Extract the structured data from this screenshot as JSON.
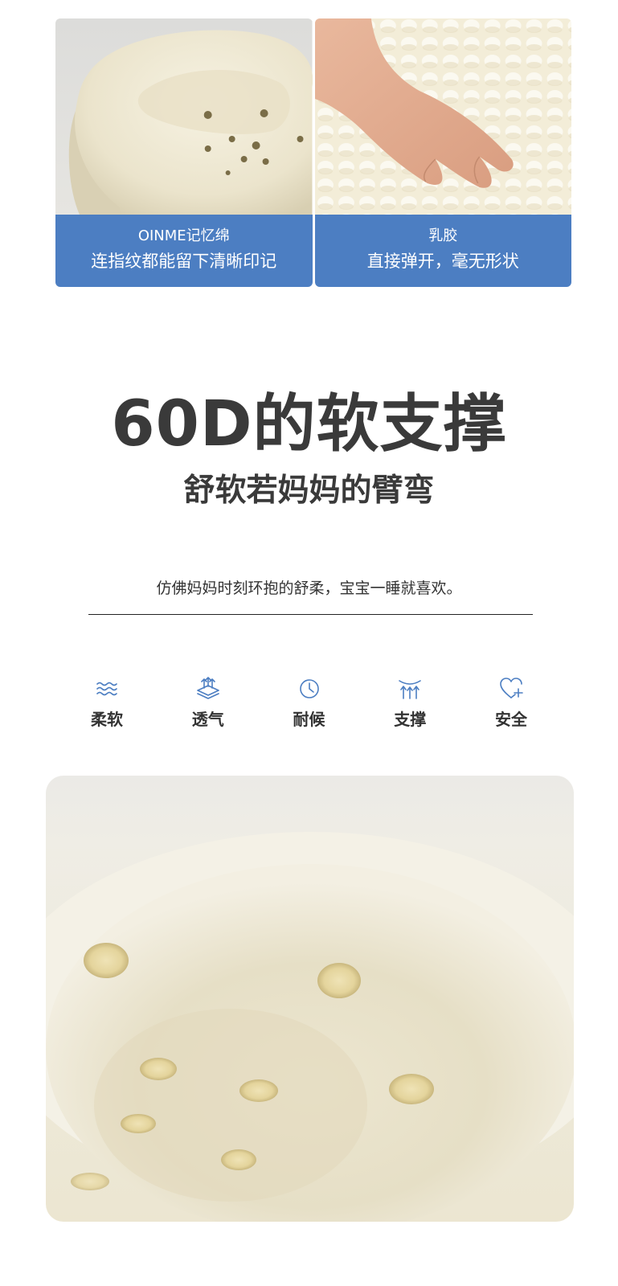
{
  "comparison": {
    "left": {
      "title": "OINME记忆绵",
      "subtitle": "连指纹都能留下清晰印记"
    },
    "right": {
      "title": "乳胶",
      "subtitle": "直接弹开，毫无形状"
    },
    "caption_color": "#4c7ec2"
  },
  "headline": "60D的软支撑",
  "subheadline": "舒软若妈妈的臂弯",
  "description": "仿佛妈妈时刻环抱的舒柔，宝宝一睡就喜欢。",
  "features": [
    {
      "icon": "wave-icon",
      "label": "柔软"
    },
    {
      "icon": "breathable-layer-icon",
      "label": "透气"
    },
    {
      "icon": "clock-icon",
      "label": "耐候"
    },
    {
      "icon": "support-arrows-icon",
      "label": "支撑"
    },
    {
      "icon": "heart-plus-icon",
      "label": "安全"
    }
  ],
  "accent_color": "#4c7ec2"
}
